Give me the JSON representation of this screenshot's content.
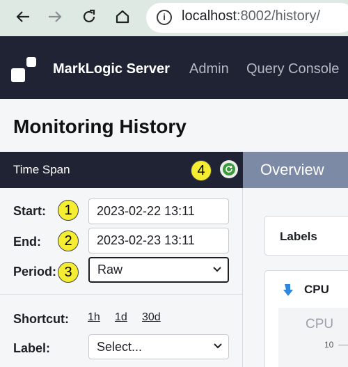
{
  "browser": {
    "url_host": "localhost",
    "url_rest": ":8002/history/"
  },
  "header": {
    "brand": "MarkLogic Server",
    "nav": [
      "Admin",
      "Query Console"
    ]
  },
  "page": {
    "title": "Monitoring History"
  },
  "time_span": {
    "title": "Time Span",
    "start_label": "Start:",
    "start_value": "2023-02-22 13:11",
    "end_label": "End:",
    "end_value": "2023-02-23 13:11",
    "period_label": "Period:",
    "period_value": "Raw",
    "shortcut_label": "Shortcut:",
    "shortcuts": [
      "1h",
      "1d",
      "30d"
    ],
    "label_label": "Label:",
    "label_value": "Select..."
  },
  "badges": [
    "1",
    "2",
    "3",
    "4"
  ],
  "main": {
    "tab": "Overview",
    "labels_card": "Labels",
    "cpu_card": "CPU",
    "chart_title": "CPU",
    "chart_tick": "10"
  },
  "icons": {
    "back": "back-arrow-icon",
    "forward": "forward-arrow-icon",
    "reload": "reload-icon",
    "home": "home-icon",
    "info": "info-icon",
    "refresh": "refresh-icon",
    "cpu": "down-arrow-icon"
  },
  "colors": {
    "header_bg": "#1f2333",
    "tab_bg": "#7d8aa6",
    "badge": "#f4ed32",
    "refresh": "#3c9a3c"
  }
}
